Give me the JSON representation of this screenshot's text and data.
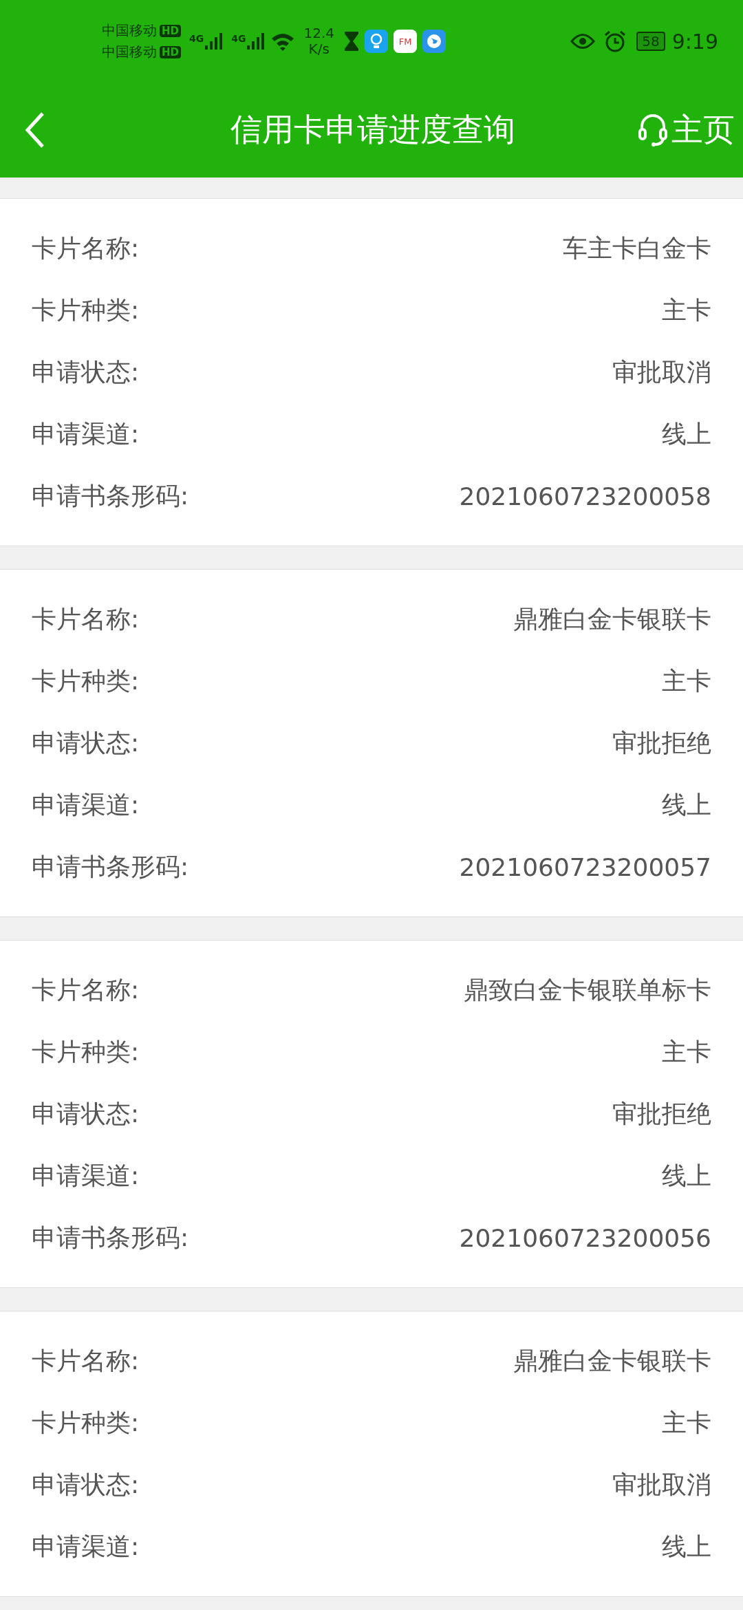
{
  "status_bar": {
    "carriers": [
      {
        "name": "中国移动",
        "badge": "HD"
      },
      {
        "name": "中国移动",
        "badge": "HD"
      }
    ],
    "networks": [
      "4G",
      "4G"
    ],
    "speed": "12.4",
    "speed_unit": "K/s",
    "fm_label": "FM",
    "battery": "58",
    "time": "9:19"
  },
  "header": {
    "title": "信用卡申请进度查询",
    "home_label": "主页"
  },
  "applications": [
    {
      "fields": [
        {
          "label": "卡片名称:",
          "value": "车主卡白金卡"
        },
        {
          "label": "卡片种类:",
          "value": "主卡"
        },
        {
          "label": "申请状态:",
          "value": "审批取消"
        },
        {
          "label": "申请渠道:",
          "value": "线上"
        },
        {
          "label": "申请书条形码:",
          "value": "2021060723200058"
        }
      ]
    },
    {
      "fields": [
        {
          "label": "卡片名称:",
          "value": "鼎雅白金卡银联卡"
        },
        {
          "label": "卡片种类:",
          "value": "主卡"
        },
        {
          "label": "申请状态:",
          "value": "审批拒绝"
        },
        {
          "label": "申请渠道:",
          "value": "线上"
        },
        {
          "label": "申请书条形码:",
          "value": "2021060723200057"
        }
      ]
    },
    {
      "fields": [
        {
          "label": "卡片名称:",
          "value": "鼎致白金卡银联单标卡"
        },
        {
          "label": "卡片种类:",
          "value": "主卡"
        },
        {
          "label": "申请状态:",
          "value": "审批拒绝"
        },
        {
          "label": "申请渠道:",
          "value": "线上"
        },
        {
          "label": "申请书条形码:",
          "value": "2021060723200056"
        }
      ]
    },
    {
      "fields": [
        {
          "label": "卡片名称:",
          "value": "鼎雅白金卡银联卡"
        },
        {
          "label": "卡片种类:",
          "value": "主卡"
        },
        {
          "label": "申请状态:",
          "value": "审批取消"
        },
        {
          "label": "申请渠道:",
          "value": "线上"
        }
      ]
    }
  ]
}
